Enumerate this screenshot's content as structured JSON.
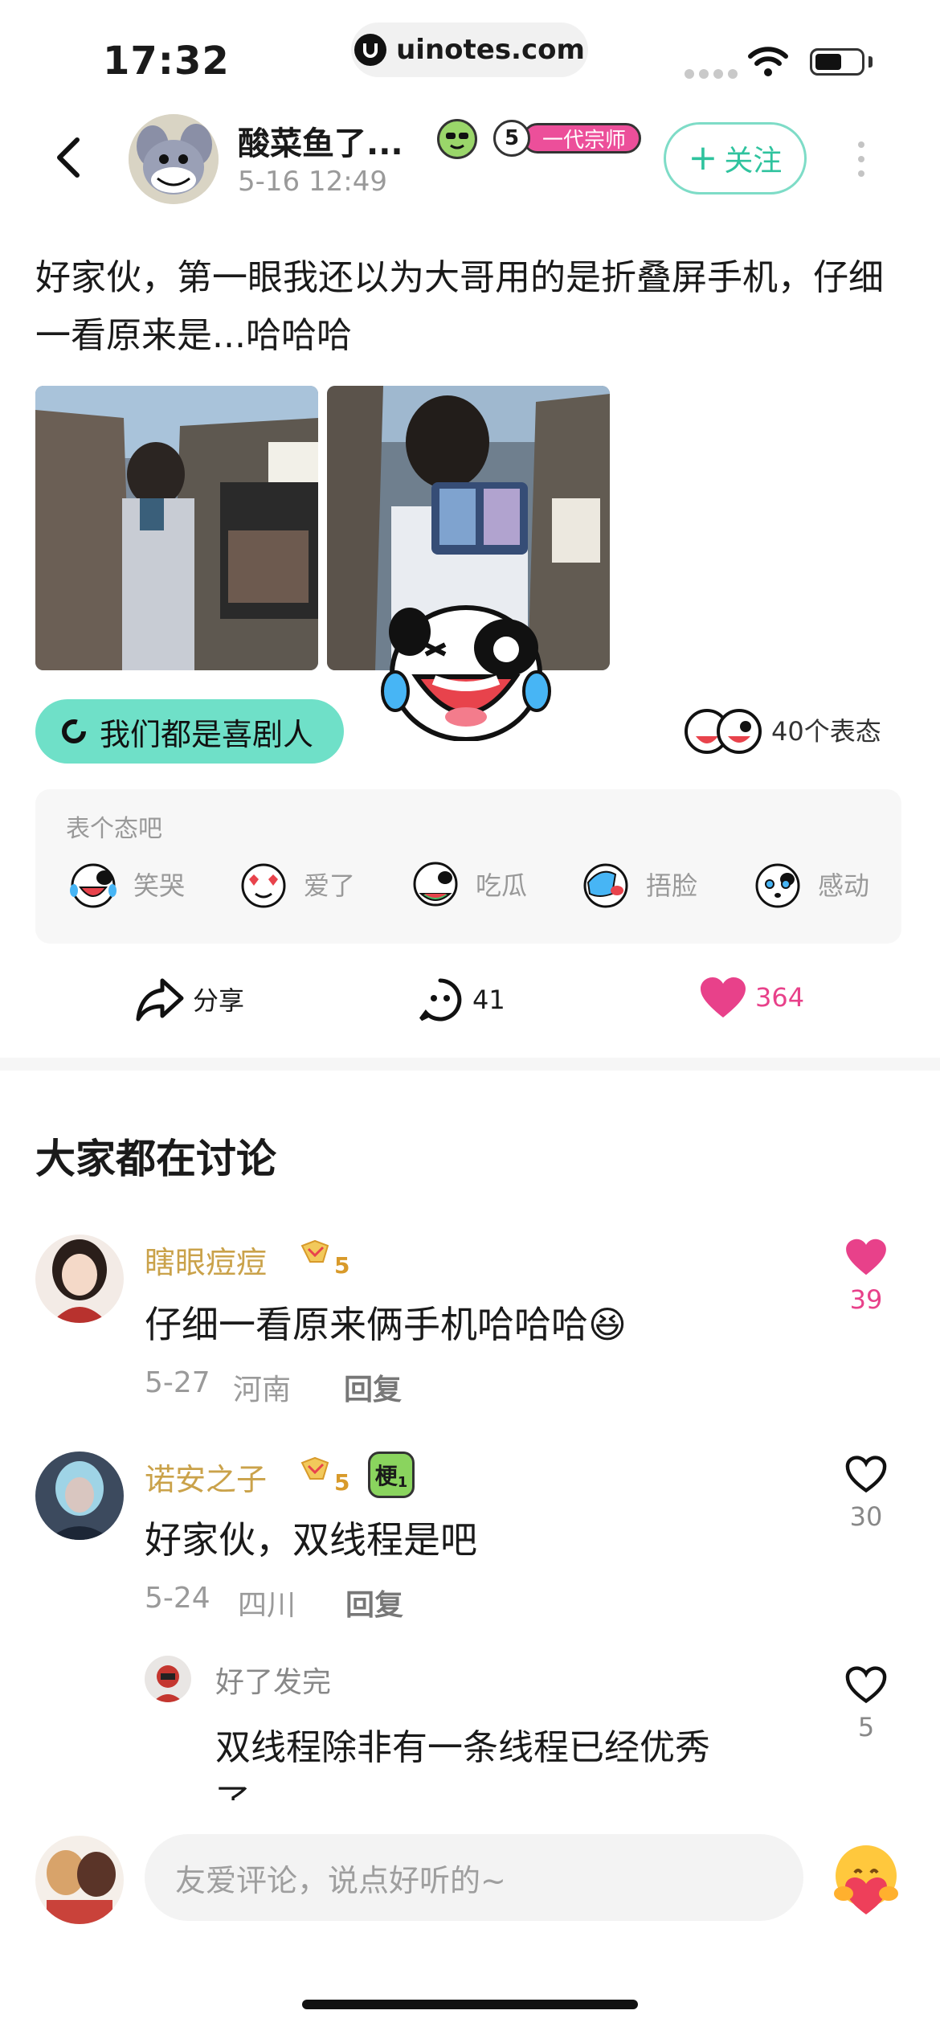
{
  "status_bar": {
    "time": "17:32",
    "url": "uinotes.com"
  },
  "post": {
    "username": "酸菜鱼了...",
    "time": "5-16 12:49",
    "level_number": "5",
    "title_badge": "一代宗师",
    "follow_label": "关注",
    "text": "好家伙，第一眼我还以为大哥用的是折叠屏手机，仔细一看原来是...哈哈哈",
    "topic_tag": "我们都是喜剧人",
    "reaction_count": "40个表态"
  },
  "reactions": {
    "title": "表个态吧",
    "items": [
      {
        "label": "笑哭",
        "icon": "laugh-cry-dog-icon"
      },
      {
        "label": "爱了",
        "icon": "heart-eyes-dog-icon"
      },
      {
        "label": "吃瓜",
        "icon": "watermelon-dog-icon"
      },
      {
        "label": "捂脸",
        "icon": "facepalm-dog-icon"
      },
      {
        "label": "感动",
        "icon": "touched-dog-icon"
      }
    ]
  },
  "actions": {
    "share": "分享",
    "comments": "41",
    "likes": "364"
  },
  "comments_section": {
    "title": "大家都在讨论",
    "comments": [
      {
        "name": "瞎眼痘痘",
        "level": "5",
        "text": "仔细一看原来俩手机哈哈哈😆",
        "date": "5-27",
        "location": "河南",
        "reply": "回复",
        "likes": "39",
        "liked": true
      },
      {
        "name": "诺安之子",
        "level": "5",
        "badge": "梗",
        "badge_level": "1",
        "text": "好家伙，双线程是吧",
        "date": "5-24",
        "location": "四川",
        "reply": "回复",
        "likes": "30",
        "liked": false
      }
    ],
    "sub_reply": {
      "name": "好了发完",
      "text_line1": "双线程除非有一条线程已经优秀",
      "text_line2": "了",
      "likes": "5"
    }
  },
  "composer": {
    "placeholder": "友爱评论，说点好听的~"
  },
  "colors": {
    "accent": "#6fe0c8",
    "like_pink": "#e8418a",
    "name_gold": "#caa24a"
  }
}
